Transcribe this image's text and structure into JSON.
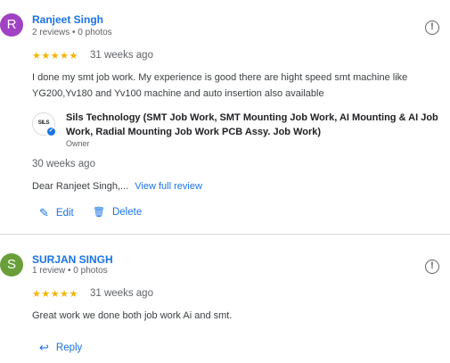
{
  "reviews": [
    {
      "avatar_letter": "R",
      "avatar_color": "#a142c4",
      "name": "Ranjeet Singh",
      "meta": "2 reviews • 0 photos",
      "stars": "★★★★★",
      "rating": 5,
      "time": "31 weeks ago",
      "text": "I done my smt job work. My experience is good there are hight speed smt machine like YG200,Yv180 and Yv100 machine and auto insertion also available",
      "owner_reply": {
        "logo_text": "SILS",
        "name": "Sils Technology (SMT Job Work, SMT Mounting Job Work, AI Mounting & AI Job Work, Radial Mounting Job Work PCB Assy. Job Work)",
        "role": "Owner",
        "time": "30 weeks ago",
        "text": "Dear Ranjeet Singh,...",
        "view_full_label": "View full review"
      },
      "actions": {
        "edit_label": "Edit",
        "delete_label": "Delete"
      }
    },
    {
      "avatar_letter": "S",
      "avatar_color": "#689f38",
      "name": "SURJAN SINGH",
      "meta": "1 review • 0 photos",
      "stars": "★★★★★",
      "rating": 5,
      "time": "31 weeks ago",
      "text": "Great work we done both job work Ai and smt.",
      "actions": {
        "reply_label": "Reply"
      }
    }
  ],
  "icons": {
    "report": "!",
    "edit": "✎",
    "delete": "🗑",
    "reply": "↩",
    "verified": "✓"
  }
}
